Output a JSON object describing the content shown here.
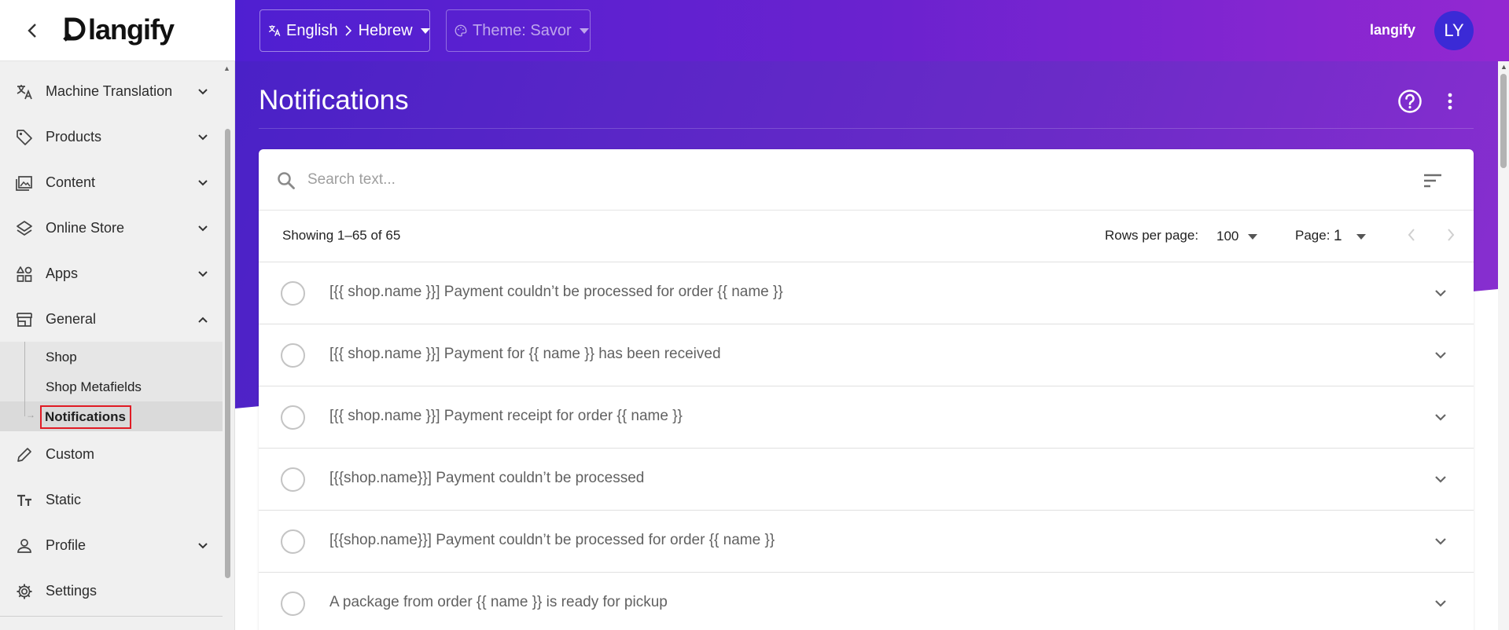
{
  "app": {
    "brand": "langify"
  },
  "sidebar": {
    "items": [
      {
        "label": "Machine Translation",
        "icon": "translate-icon",
        "expandable": true
      },
      {
        "label": "Products",
        "icon": "tag-icon",
        "expandable": true
      },
      {
        "label": "Content",
        "icon": "image-gallery-icon",
        "expandable": true
      },
      {
        "label": "Online Store",
        "icon": "layers-icon",
        "expandable": true
      },
      {
        "label": "Apps",
        "icon": "apps-shapes-icon",
        "expandable": true
      },
      {
        "label": "General",
        "icon": "store-icon",
        "expandable": true,
        "expanded": true
      },
      {
        "label": "Custom",
        "icon": "pencil-icon",
        "expandable": false
      },
      {
        "label": "Static",
        "icon": "text-size-icon",
        "expandable": false
      },
      {
        "label": "Profile",
        "icon": "person-icon",
        "expandable": true
      },
      {
        "label": "Settings",
        "icon": "gear-icon",
        "expandable": false
      }
    ],
    "general_sub": [
      {
        "label": "Shop"
      },
      {
        "label": "Shop Metafields"
      },
      {
        "label": "Notifications",
        "active": true
      }
    ]
  },
  "topbar": {
    "lang_from": "English",
    "lang_to": "Hebrew",
    "theme": "Theme: Savor",
    "user": "langify",
    "avatar_initials": "LY"
  },
  "page": {
    "title": "Notifications"
  },
  "search": {
    "placeholder": "Search text..."
  },
  "pagination": {
    "showing": "Showing 1–65 of 65",
    "rows_per_page_label": "Rows per page:",
    "rows_per_page": "100",
    "page_label": "Page:",
    "page": "1"
  },
  "rows": [
    {
      "text": "[{{ shop.name }}] Payment couldn’t be processed for order {{ name }}"
    },
    {
      "text": "[{{ shop.name }}] Payment for {{ name }} has been received"
    },
    {
      "text": "[{{ shop.name }}] Payment receipt for order {{ name }}"
    },
    {
      "text": "[{{shop.name}}] Payment couldn’t be processed"
    },
    {
      "text": "[{{shop.name}}] Payment couldn’t be processed for order {{ name }}"
    },
    {
      "text": "A package from order {{ name }} is ready for pickup"
    }
  ],
  "colors": {
    "accent_start": "#4f1fd1",
    "accent_end": "#9328d1",
    "highlight_border": "#e01b24"
  }
}
